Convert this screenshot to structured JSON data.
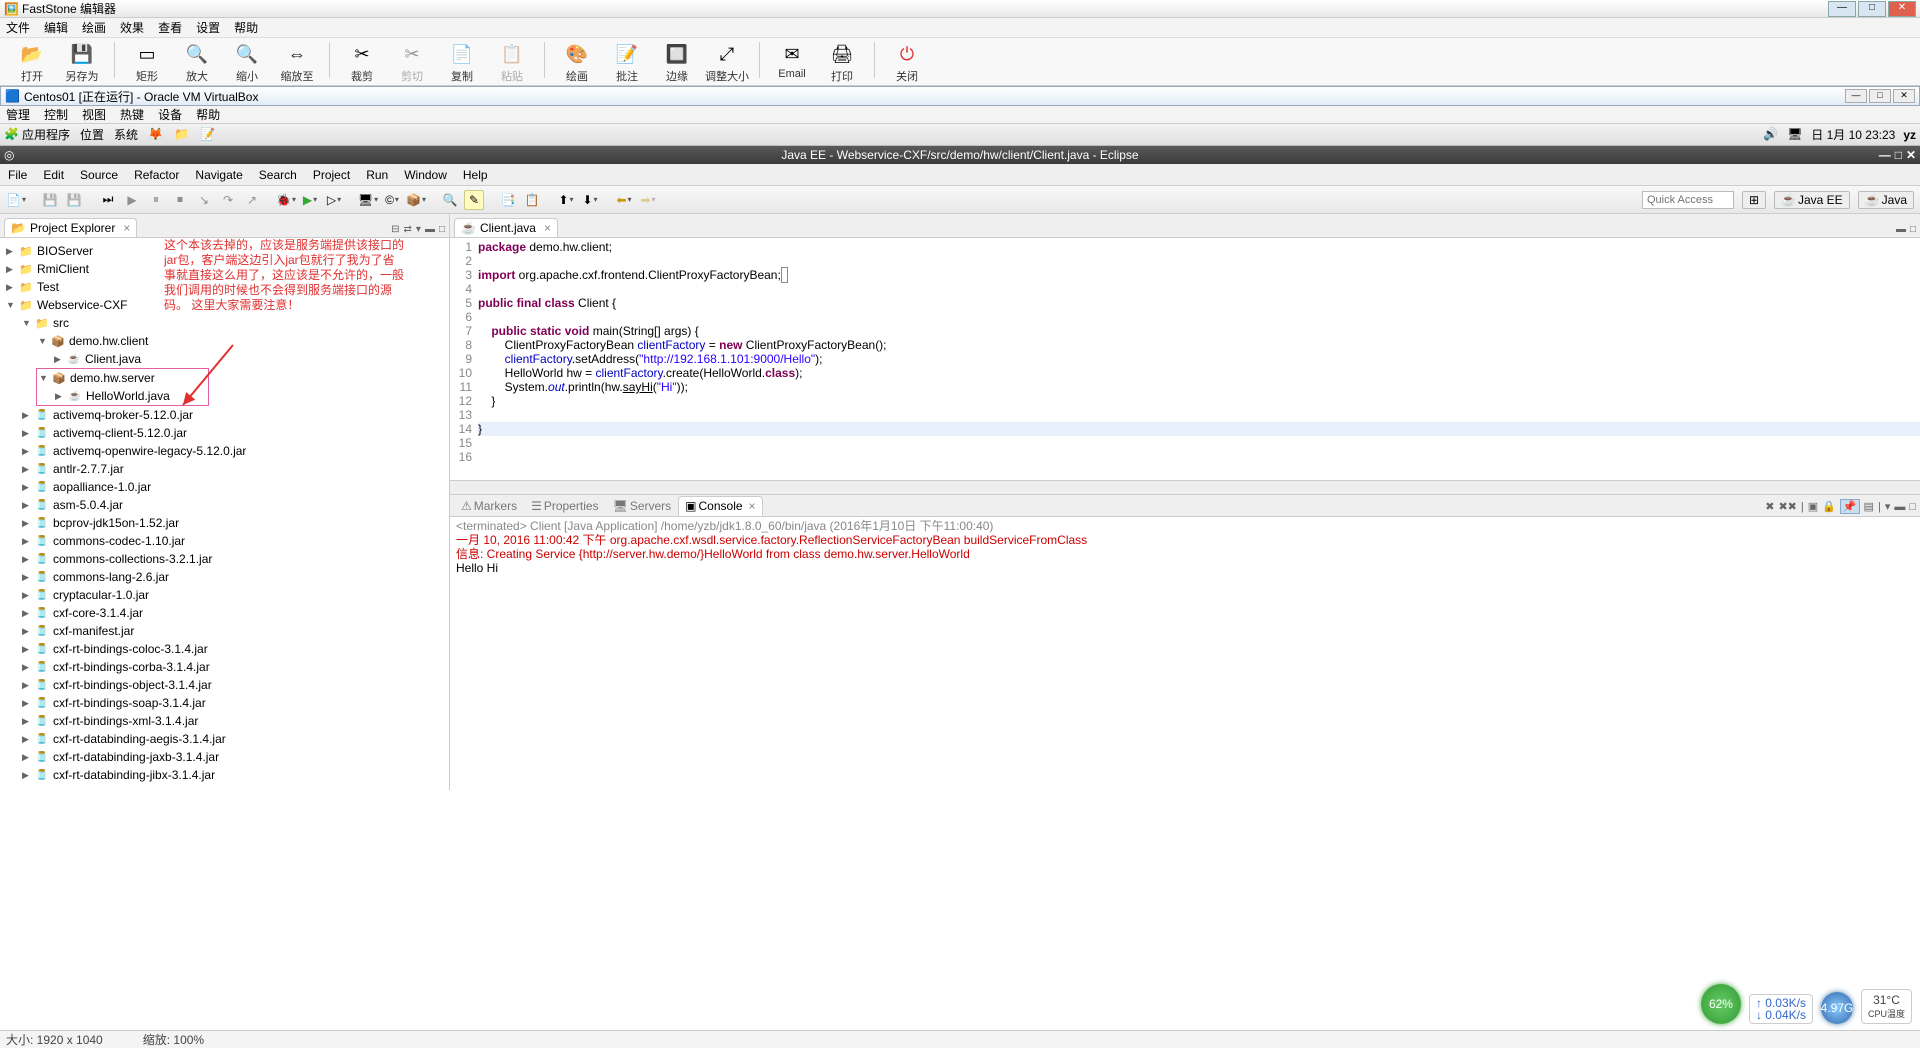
{
  "faststone": {
    "title": "FastStone 编辑器",
    "menu": [
      "文件",
      "编辑",
      "绘画",
      "效果",
      "查看",
      "设置",
      "帮助"
    ],
    "tools": [
      "打开",
      "另存为",
      "矩形",
      "放大",
      "缩小",
      "缩放至",
      "裁剪",
      "剪切",
      "复制",
      "粘贴",
      "绘画",
      "批注",
      "边缘",
      "调整大小",
      "Email",
      "打印",
      "关闭"
    ],
    "status_left": "大小: 1920 x 1040",
    "status_zoom": "缩放: 100%"
  },
  "virtualbox": {
    "title": "Centos01 [正在运行] - Oracle VM VirtualBox",
    "menu": [
      "管理",
      "控制",
      "视图",
      "热键",
      "设备",
      "帮助"
    ]
  },
  "linux_top": {
    "apps": "应用程序",
    "places": "位置",
    "system": "系统",
    "clock": "日 1月 10 23:23",
    "user": "yz"
  },
  "eclipse": {
    "title": "Java EE - Webservice-CXF/src/demo/hw/client/Client.java - Eclipse",
    "menu": [
      "File",
      "Edit",
      "Source",
      "Refactor",
      "Navigate",
      "Search",
      "Project",
      "Run",
      "Window",
      "Help"
    ],
    "quick_access": "Quick Access",
    "perspectives": [
      "Java EE",
      "Java"
    ],
    "project_explorer": {
      "label": "Project Explorer",
      "root_projects": [
        "BIOServer",
        "RmiClient",
        "Test"
      ],
      "main_project": "Webservice-CXF",
      "src": "src",
      "pkg_client": "demo.hw.client",
      "file_client": "Client.java",
      "pkg_server": "demo.hw.server",
      "file_hello": "HelloWorld.java",
      "jars": [
        "activemq-broker-5.12.0.jar",
        "activemq-client-5.12.0.jar",
        "activemq-openwire-legacy-5.12.0.jar",
        "antlr-2.7.7.jar",
        "aopalliance-1.0.jar",
        "asm-5.0.4.jar",
        "bcprov-jdk15on-1.52.jar",
        "commons-codec-1.10.jar",
        "commons-collections-3.2.1.jar",
        "commons-lang-2.6.jar",
        "cryptacular-1.0.jar",
        "cxf-core-3.1.4.jar",
        "cxf-manifest.jar",
        "cxf-rt-bindings-coloc-3.1.4.jar",
        "cxf-rt-bindings-corba-3.1.4.jar",
        "cxf-rt-bindings-object-3.1.4.jar",
        "cxf-rt-bindings-soap-3.1.4.jar",
        "cxf-rt-bindings-xml-3.1.4.jar",
        "cxf-rt-databinding-aegis-3.1.4.jar",
        "cxf-rt-databinding-jaxb-3.1.4.jar",
        "cxf-rt-databinding-jibx-3.1.4.jar"
      ]
    },
    "editor": {
      "tab": "Client.java",
      "line_start": 1,
      "line_end": 16,
      "lines": {
        "l1": "package demo.hw.client;",
        "l3": "import org.apache.cxf.frontend.ClientProxyFactoryBean;",
        "l6": "public final class Client {",
        "l8": "    public static void main(String[] args) {",
        "l9": "        ClientProxyFactoryBean clientFactory = new ClientProxyFactoryBean();",
        "l10a": "        clientFactory.setAddress(",
        "l10s": "\"http://192.168.1.101:9000/Hello\"",
        "l10b": ");",
        "l11a": "        HelloWorld hw = clientFactory.create(HelloWorld.",
        "l11b": "class",
        "l11c": ");",
        "l12a": "        System.",
        "l12b": "out",
        "l12c": ".println(hw.sayHi(",
        "l12s": "\"Hi\"",
        "l12d": "));",
        "l13": "    }",
        "l15": "}"
      }
    },
    "bottom_tabs": [
      "Markers",
      "Properties",
      "Servers",
      "Console"
    ],
    "console": {
      "label": "Console",
      "terminated": "<terminated> Client [Java Application] /home/yzb/jdk1.8.0_60/bin/java (2016年1月10日 下午11:00:40)",
      "line1": "一月 10, 2016 11:00:42 下午 org.apache.cxf.wsdl.service.factory.ReflectionServiceFactoryBean buildServiceFromClass",
      "line2": "信息: Creating Service {http://server.hw.demo/}HelloWorld from class demo.hw.server.HelloWorld",
      "line3": "Hello Hi"
    }
  },
  "annotation": {
    "text": "这个本该去掉的，应该是服务端提供该接口的jar包，客户端这边引入jar包就行了我为了省事就直接这么用了，这应该是不允许的，一般我们调用的时候也不会得到服务端接口的源码。\n这里大家需要注意！"
  },
  "overlays": {
    "cpu": "62%",
    "net_up": "↑ 0.03K/s",
    "net_dn": "↓ 0.04K/s",
    "ram": "4.97G",
    "temp": "31°C",
    "temp_lbl": "CPU温度"
  }
}
